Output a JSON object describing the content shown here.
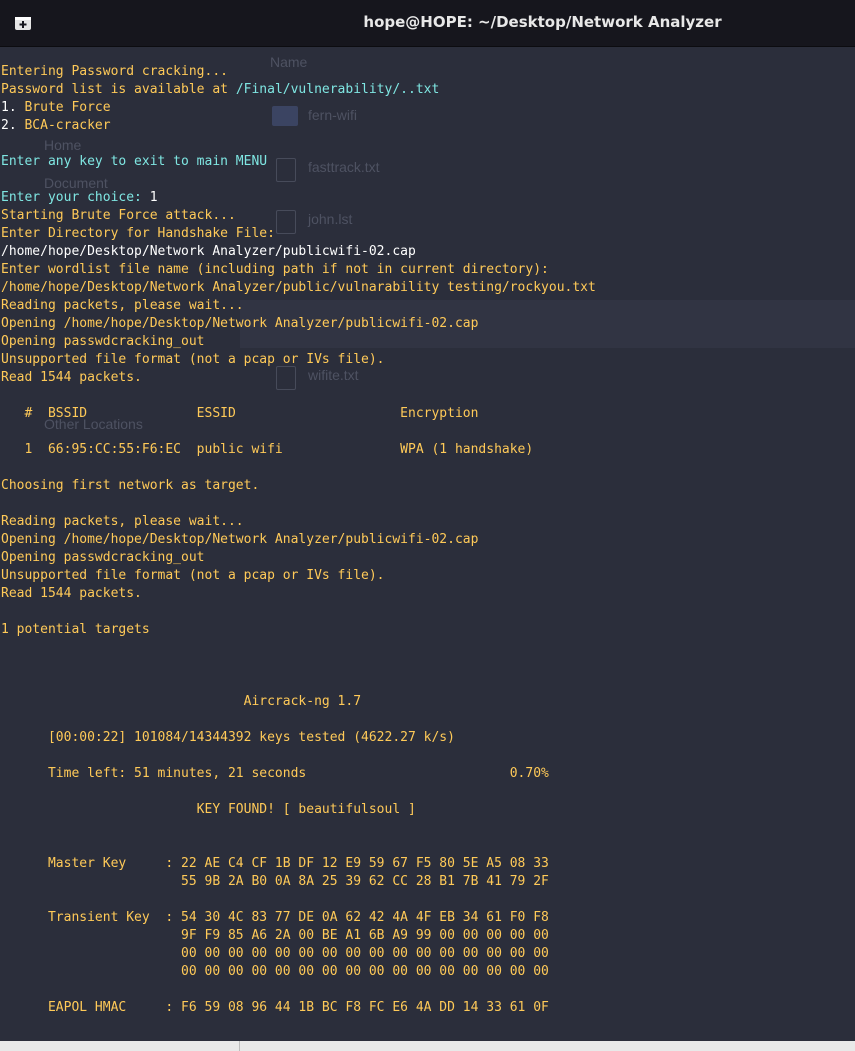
{
  "window": {
    "title": "hope@HOPE: ~/Desktop/Network Analyzer",
    "new_tab_icon": "new-tab-icon"
  },
  "background_file_manager": {
    "column_header": "Name",
    "sidebar": [
      "Home",
      "Document",
      "Other Locations"
    ],
    "files": [
      "fern-wifi",
      "fasttrack.txt",
      "john.lst",
      "wifite.txt"
    ]
  },
  "colors": {
    "terminal_background": "#2b2e3b",
    "titlebar_background": "#16161d",
    "output_text": "#ffca58",
    "prompt_text": "#7fe6e2",
    "input_text": "#ffffff"
  },
  "terminal": {
    "lines": [
      [
        {
          "t": "Entering Password cracking...",
          "c": ""
        }
      ],
      [
        {
          "t": "Password list is available at ",
          "c": ""
        },
        {
          "t": "/Final/vulnerability/..txt",
          "c": "c"
        }
      ],
      [
        {
          "t": "1. ",
          "c": "w"
        },
        {
          "t": "Brute Force",
          "c": ""
        }
      ],
      [
        {
          "t": "2. ",
          "c": "w"
        },
        {
          "t": "BCA-cracker",
          "c": ""
        }
      ],
      [
        {
          "t": "",
          "c": ""
        }
      ],
      [
        {
          "t": "Enter any key to exit to main MENU",
          "c": "c"
        }
      ],
      [
        {
          "t": "",
          "c": ""
        }
      ],
      [
        {
          "t": "Enter your choice: ",
          "c": "c"
        },
        {
          "t": "1",
          "c": "w"
        }
      ],
      [
        {
          "t": "Starting Brute Force attack...",
          "c": ""
        }
      ],
      [
        {
          "t": "Enter Directory for Handshake File:",
          "c": ""
        }
      ],
      [
        {
          "t": "/home/hope/Desktop/Network Analyzer/publicwifi-02.cap",
          "c": "w"
        }
      ],
      [
        {
          "t": "Enter wordlist file name (including path if not in current directory):",
          "c": ""
        }
      ],
      [
        {
          "t": "/home/hope/Desktop/Network Analyzer/public/vulnarability testing/rockyou.txt",
          "c": ""
        }
      ],
      [
        {
          "t": "Reading packets, please wait...",
          "c": ""
        }
      ],
      [
        {
          "t": "Opening /home/hope/Desktop/Network Analyzer/publicwifi-02.cap",
          "c": ""
        }
      ],
      [
        {
          "t": "Opening passwdcracking_out",
          "c": ""
        }
      ],
      [
        {
          "t": "Unsupported file format (not a pcap or IVs file).",
          "c": ""
        }
      ],
      [
        {
          "t": "Read 1544 packets.",
          "c": ""
        }
      ],
      [
        {
          "t": "",
          "c": ""
        }
      ],
      [
        {
          "t": "   #  BSSID              ESSID                     Encryption",
          "c": ""
        }
      ],
      [
        {
          "t": "",
          "c": ""
        }
      ],
      [
        {
          "t": "   1  66:95:CC:55:F6:EC  public wifi               WPA (1 handshake)",
          "c": ""
        }
      ],
      [
        {
          "t": "",
          "c": ""
        }
      ],
      [
        {
          "t": "Choosing first network as target.",
          "c": ""
        }
      ],
      [
        {
          "t": "",
          "c": ""
        }
      ],
      [
        {
          "t": "Reading packets, please wait...",
          "c": ""
        }
      ],
      [
        {
          "t": "Opening /home/hope/Desktop/Network Analyzer/publicwifi-02.cap",
          "c": ""
        }
      ],
      [
        {
          "t": "Opening passwdcracking_out",
          "c": ""
        }
      ],
      [
        {
          "t": "Unsupported file format (not a pcap or IVs file).",
          "c": ""
        }
      ],
      [
        {
          "t": "Read 1544 packets.",
          "c": ""
        }
      ],
      [
        {
          "t": "",
          "c": ""
        }
      ],
      [
        {
          "t": "1 potential targets",
          "c": ""
        }
      ],
      [
        {
          "t": "",
          "c": ""
        }
      ],
      [
        {
          "t": "",
          "c": ""
        }
      ],
      [
        {
          "t": "",
          "c": ""
        }
      ],
      [
        {
          "t": "                               Aircrack-ng 1.7",
          "c": ""
        }
      ],
      [
        {
          "t": "",
          "c": ""
        }
      ],
      [
        {
          "t": "      [00:00:22] 101084/14344392 keys tested (4622.27 k/s)",
          "c": ""
        }
      ],
      [
        {
          "t": "",
          "c": ""
        }
      ],
      [
        {
          "t": "      Time left: 51 minutes, 21 seconds                          0.70%",
          "c": ""
        }
      ],
      [
        {
          "t": "",
          "c": ""
        }
      ],
      [
        {
          "t": "                         KEY FOUND! [ beautifulsoul ]",
          "c": ""
        }
      ],
      [
        {
          "t": "",
          "c": ""
        }
      ],
      [
        {
          "t": "",
          "c": ""
        }
      ],
      [
        {
          "t": "      Master Key     : 22 AE C4 CF 1B DF 12 E9 59 67 F5 80 5E A5 08 33",
          "c": ""
        }
      ],
      [
        {
          "t": "                       55 9B 2A B0 0A 8A 25 39 62 CC 28 B1 7B 41 79 2F",
          "c": ""
        }
      ],
      [
        {
          "t": "",
          "c": ""
        }
      ],
      [
        {
          "t": "      Transient Key  : 54 30 4C 83 77 DE 0A 62 42 4A 4F EB 34 61 F0 F8",
          "c": ""
        }
      ],
      [
        {
          "t": "                       9F F9 85 A6 2A 00 BE A1 6B A9 99 00 00 00 00 00",
          "c": ""
        }
      ],
      [
        {
          "t": "                       00 00 00 00 00 00 00 00 00 00 00 00 00 00 00 00",
          "c": ""
        }
      ],
      [
        {
          "t": "                       00 00 00 00 00 00 00 00 00 00 00 00 00 00 00 00",
          "c": ""
        }
      ],
      [
        {
          "t": "",
          "c": ""
        }
      ],
      [
        {
          "t": "      EAPOL HMAC     : F6 59 08 96 44 1B BC F8 FC E6 4A DD 14 33 61 0F",
          "c": ""
        }
      ]
    ]
  }
}
